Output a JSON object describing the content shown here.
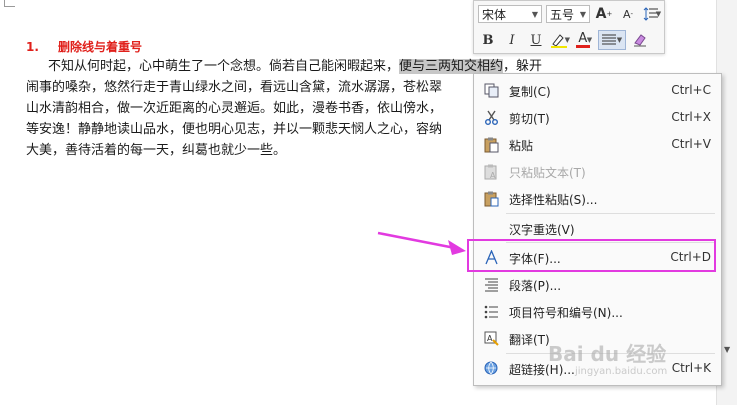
{
  "document": {
    "heading_number": "1.",
    "heading_text": "删除线与着重号",
    "lines": [
      {
        "pre": "不知从何时起，心中萌生了一个念想。倘若自己能闲暇起来，",
        "hl": "便与三两知交相约",
        "post": "，躲开"
      },
      {
        "pre": "闹事的嗓杂，悠然行走于青山绿水之间，看远山含黛，流水潺潺，苍松翠",
        "hl": "",
        "post": ""
      },
      {
        "pre": "山水清韵相合，做一次近距离的心灵邂逅。如此，漫卷书香，依山傍水，",
        "hl": "",
        "post": ""
      },
      {
        "pre": "等安逸！静静地读山品水，便也明心见志，并以一颗悲天悯人之心，容纳",
        "hl": "",
        "post": ""
      },
      {
        "pre": "大美，善待活着的每一天，纠葛也就少一些。",
        "hl": "",
        "post": ""
      }
    ]
  },
  "toolbar": {
    "font_name": "宋体",
    "font_size": "五号",
    "grow_font": "A",
    "shrink_font": "A",
    "bold": "B",
    "italic": "I",
    "underline": "U",
    "font_color": "A",
    "font_color_hex": "#e0201b"
  },
  "menu": {
    "items": [
      {
        "label": "复制(C)",
        "shortcut": "Ctrl+C",
        "icon": "copy-icon"
      },
      {
        "label": "剪切(T)",
        "shortcut": "Ctrl+X",
        "icon": "scissors-icon"
      },
      {
        "label": "粘贴",
        "shortcut": "Ctrl+V",
        "icon": "paste-icon"
      },
      {
        "label": "只粘贴文本(T)",
        "shortcut": "",
        "icon": "paste-text-icon"
      },
      {
        "label": "选择性粘贴(S)...",
        "shortcut": "",
        "icon": "paste-special-icon"
      },
      {
        "label": "汉字重选(V)",
        "shortcut": "",
        "icon": ""
      },
      {
        "label": "字体(F)...",
        "shortcut": "Ctrl+D",
        "icon": "font-icon"
      },
      {
        "label": "段落(P)...",
        "shortcut": "",
        "icon": "paragraph-icon"
      },
      {
        "label": "项目符号和编号(N)...",
        "shortcut": "",
        "icon": "bullets-icon"
      },
      {
        "label": "翻译(T)",
        "shortcut": "",
        "icon": "translate-icon"
      },
      {
        "label": "超链接(H)...",
        "shortcut": "Ctrl+K",
        "icon": "hyperlink-icon"
      }
    ]
  },
  "watermark": {
    "main": "Bai du 经验",
    "sub": "jingyan.baidu.com"
  },
  "colors": {
    "highlight_box": "#e23ae0",
    "heading": "#e0201b"
  }
}
